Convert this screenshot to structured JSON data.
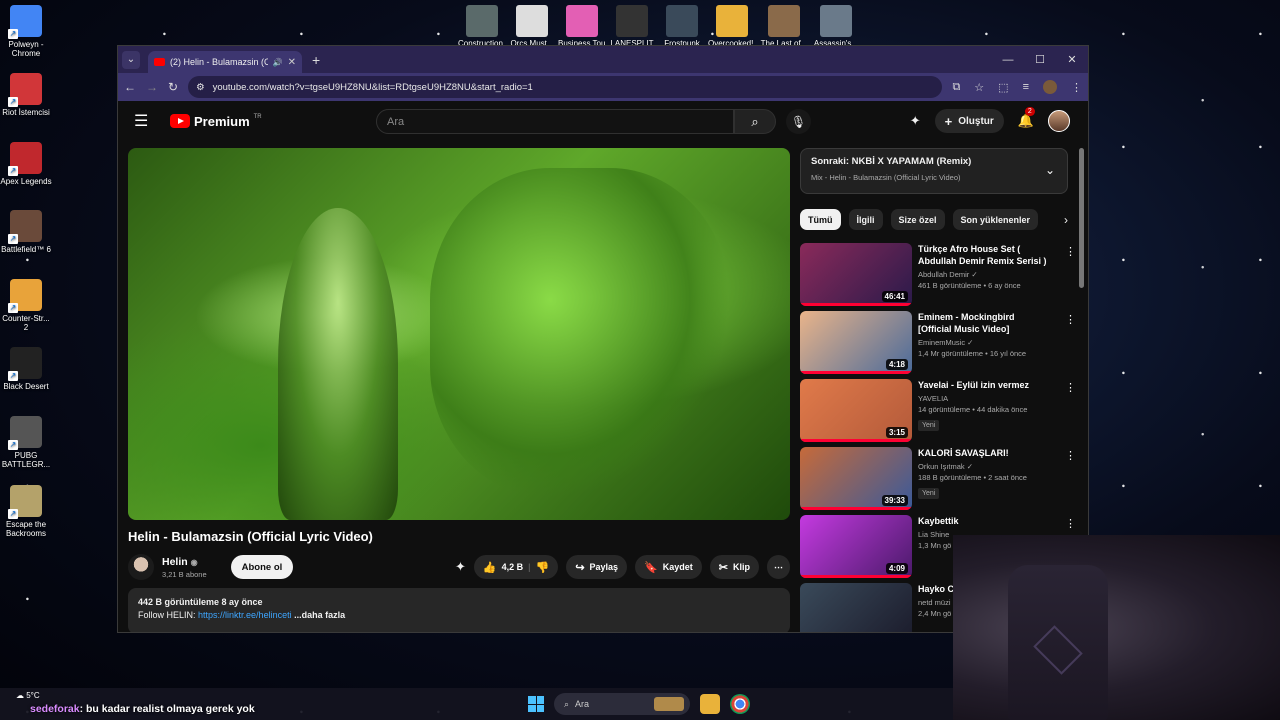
{
  "desktop": {
    "left_icons": [
      {
        "label": "Polweyn - Chrome",
        "color": "#4285f4"
      },
      {
        "label": "Riot İstemcisi",
        "color": "#d13639"
      },
      {
        "label": "Apex Legends",
        "color": "#c0282d"
      },
      {
        "label": "Battlefield™ 6",
        "color": "#6a4a3a"
      },
      {
        "label": "Counter-Str... 2",
        "color": "#e8a33a"
      },
      {
        "label": "Black Desert",
        "color": "#222222"
      },
      {
        "label": "PUBG BATTLEGR...",
        "color": "#555555"
      },
      {
        "label": "Escape the Backrooms",
        "color": "#b4a26a"
      }
    ],
    "top_icons": [
      {
        "label": "Construction...",
        "color": "#5a6a6a"
      },
      {
        "label": "Orcs Must...",
        "color": "#dddddd"
      },
      {
        "label": "Business Tour...",
        "color": "#e35fb4"
      },
      {
        "label": "LANESPLIT",
        "color": "#333333"
      },
      {
        "label": "Frostpunk",
        "color": "#3a4a5a"
      },
      {
        "label": "Overcooked!...",
        "color": "#e9b23a"
      },
      {
        "label": "The Last of...",
        "color": "#8a6a4a"
      },
      {
        "label": "Assassin's...",
        "color": "#6a7a8a"
      }
    ]
  },
  "browser": {
    "tab_title": "(2) Helin - Bulamazsin (Offic",
    "url": "youtube.com/watch?v=tgseU9HZ8NU&list=RDtgseU9HZ8NU&start_radio=1"
  },
  "yt": {
    "logo_text": "Premium",
    "logo_sup": "TR",
    "search_placeholder": "Ara",
    "create_label": "Oluştur",
    "notif_count": "2"
  },
  "video": {
    "title": "Helin - Bulamazsin (Official Lyric Video)",
    "channel": "Helin",
    "subs": "3,21 B abone",
    "subscribe_label": "Abone ol",
    "likes": "4,2 B",
    "share": "Paylaş",
    "save": "Kaydet",
    "clip": "Klip",
    "views_date": "442 B görüntüleme  8 ay önce",
    "desc_prefix": "Follow HELIN: ",
    "desc_link": "https://linktr.ee/helinceti",
    "desc_more": " ...daha fazla"
  },
  "up_next": {
    "title": "Sonraki: NKBİ X YAPAMAM (Remix)",
    "subtitle": "Mix - Helin - Bulamazsin (Official Lyric Video)"
  },
  "chips": [
    "Tümü",
    "İlgili",
    "Size özel",
    "Son yüklenenler"
  ],
  "recommendations": [
    {
      "title": "Türkçe Afro House Set ( Abdullah Demir Remix Serisi )",
      "channel": "Abdullah Demir ✓",
      "meta": "461 B görüntüleme • 6 ay önce",
      "duration": "46:41",
      "badge": "",
      "color1": "#8a2a5a",
      "color2": "#2a1a4a"
    },
    {
      "title": "Eminem - Mockingbird [Official Music Video]",
      "channel": "EminemMusic ✓",
      "meta": "1,4 Mr görüntüleme • 16 yıl önce",
      "duration": "4:18",
      "badge": "",
      "color1": "#e9b48a",
      "color2": "#4a6a9a"
    },
    {
      "title": "Yavelai - Eylül izin vermez",
      "channel": "YAVELIA",
      "meta": "14 görüntüleme • 44 dakika önce",
      "duration": "3:15",
      "badge": "Yeni",
      "color1": "#e07a4a",
      "color2": "#b35a3a"
    },
    {
      "title": "KALORİ SAVAŞLARI!",
      "channel": "Orkun Işıtmak ✓",
      "meta": "188 B görüntüleme • 2 saat önce",
      "duration": "39:33",
      "badge": "Yeni",
      "color1": "#c66a3a",
      "color2": "#3a5a9a"
    },
    {
      "title": "Kaybettik",
      "channel": "Lia Shine",
      "meta": "1,3 Mn gö",
      "duration": "4:09",
      "badge": "",
      "color1": "#c43ae0",
      "color2": "#4a1a6a"
    },
    {
      "title": "Hayko Ce",
      "channel": "netd müzi",
      "meta": "2,4 Mn gö",
      "duration": "",
      "badge": "",
      "color1": "#3a4a5a",
      "color2": "#1a1a2a"
    }
  ],
  "taskbar": {
    "weather": "5°C",
    "chat_user": "sedeforak",
    "chat_msg": ": bu kadar realist olmaya gerek yok",
    "search": "Ara"
  }
}
